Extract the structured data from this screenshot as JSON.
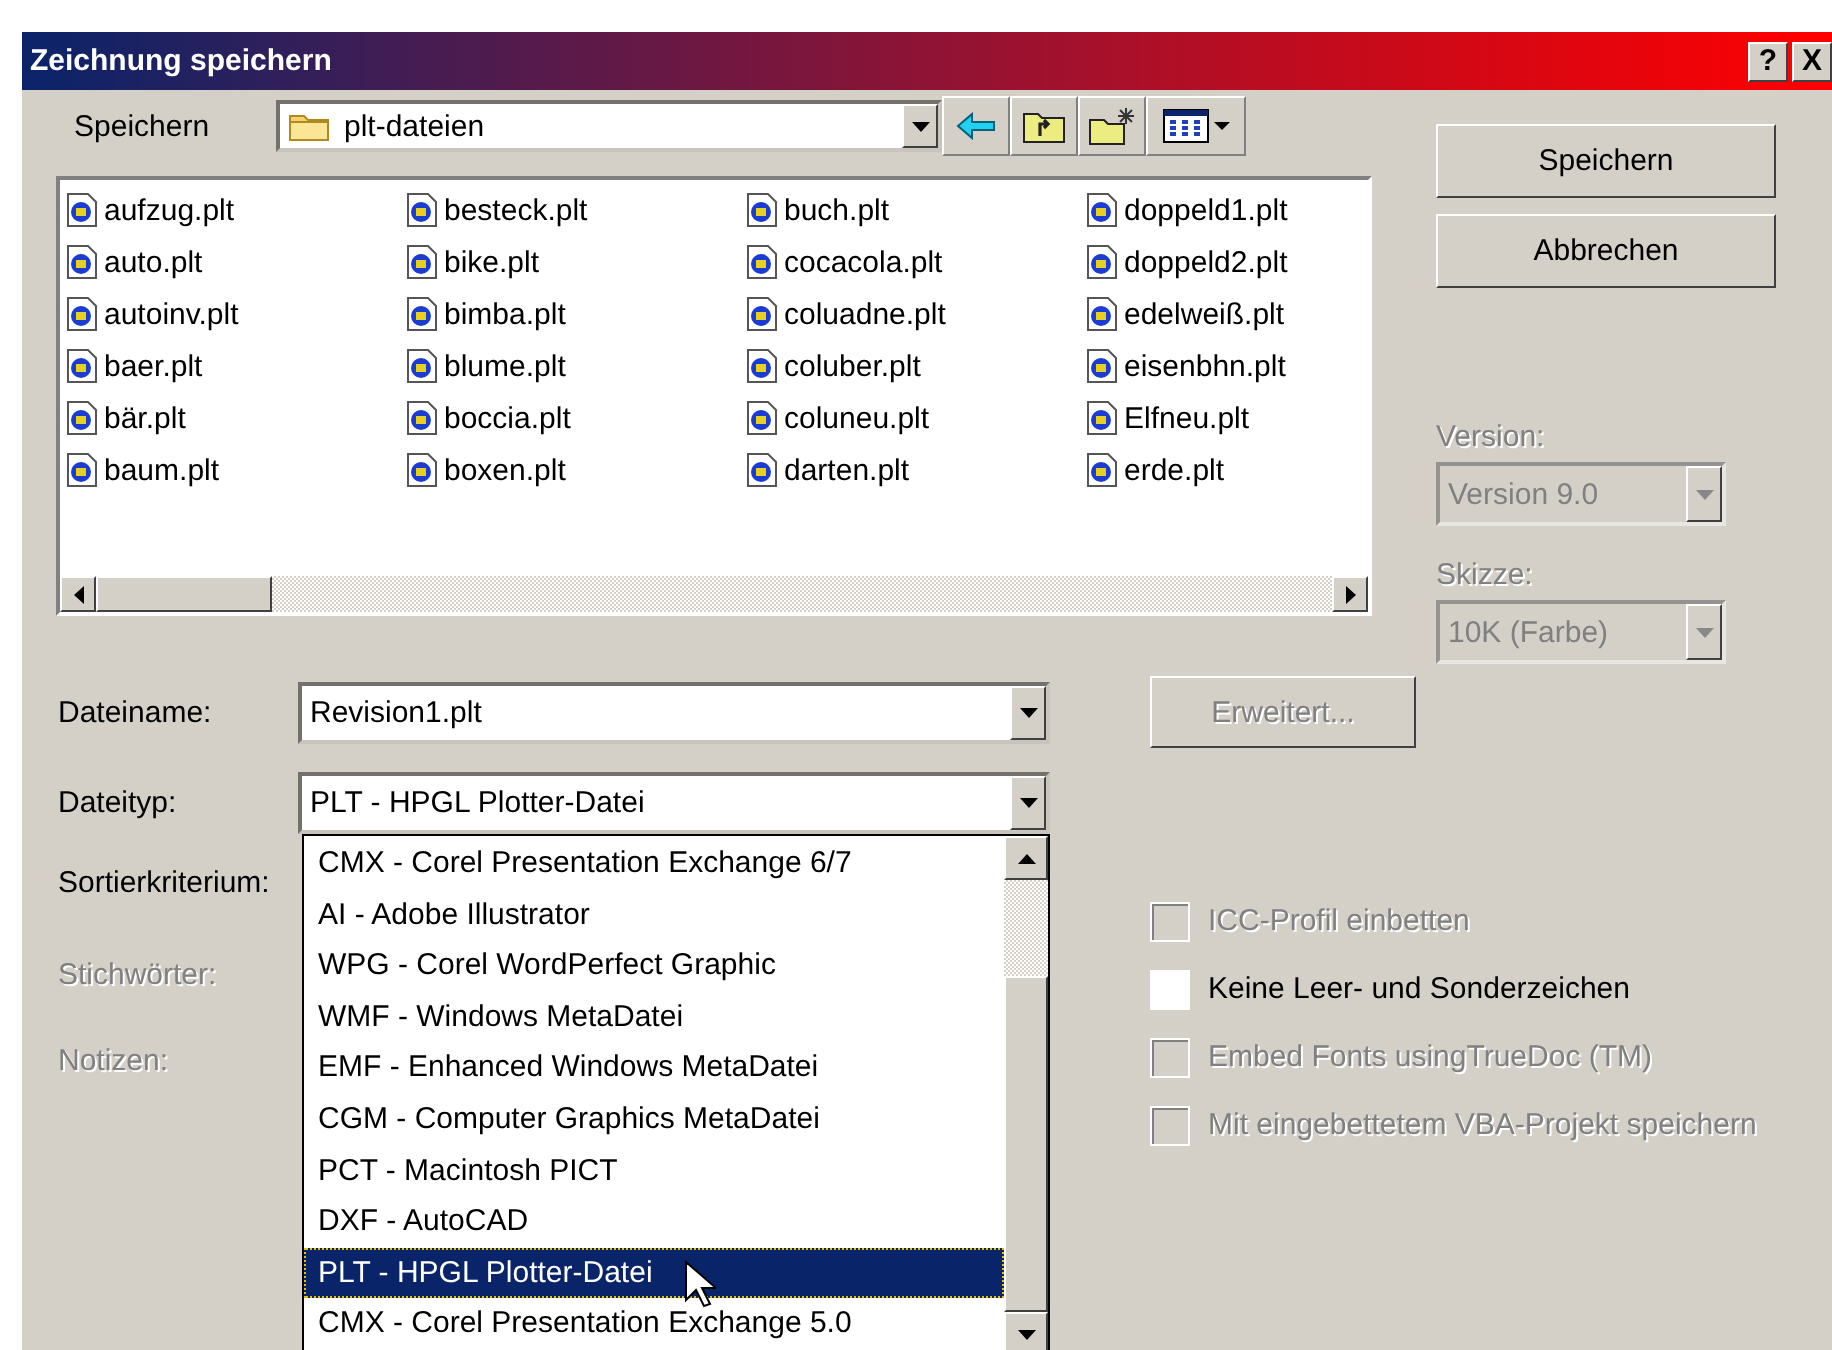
{
  "window": {
    "title": "Zeichnung speichern",
    "help": "?",
    "close": "X"
  },
  "save_in": {
    "label": "Speichern",
    "folder": "plt-dateien"
  },
  "files": [
    "aufzug.plt",
    "auto.plt",
    "autoinv.plt",
    "baer.plt",
    "bär.plt",
    "baum.plt",
    "besteck.plt",
    "bike.plt",
    "bimba.plt",
    "blume.plt",
    "boccia.plt",
    "boxen.plt",
    "buch.plt",
    "cocacola.plt",
    "coluadne.plt",
    "coluber.plt",
    "coluneu.plt",
    "darten.plt",
    "doppeld1.plt",
    "doppeld2.plt",
    "edelweiß.plt",
    "eisenbhn.plt",
    "Elfneu.plt",
    "erde.plt"
  ],
  "buttons": [
    {
      "label": "Speichern",
      "disabled": false
    },
    {
      "label": "Abbrechen",
      "disabled": false
    }
  ],
  "version": {
    "label": "Version:",
    "value": "Version 9.0",
    "disabled": true
  },
  "sketch": {
    "label": "Skizze:",
    "value": "10K (Farbe)",
    "disabled": true
  },
  "filename": {
    "label": "Dateiname:",
    "value": "Revision1.plt"
  },
  "filetype": {
    "label": "Dateityp:",
    "value": "PLT - HPGL Plotter-Datei",
    "expanded": true,
    "options": [
      {
        "label": "CMX - Corel Presentation Exchange 6/7",
        "selected": false
      },
      {
        "label": "AI - Adobe Illustrator",
        "selected": false
      },
      {
        "label": "WPG - Corel WordPerfect Graphic",
        "selected": false
      },
      {
        "label": "WMF - Windows MetaDatei",
        "selected": false
      },
      {
        "label": "EMF - Enhanced Windows MetaDatei",
        "selected": false
      },
      {
        "label": "CGM - Computer Graphics MetaDatei",
        "selected": false
      },
      {
        "label": "PCT - Macintosh PICT",
        "selected": false
      },
      {
        "label": "DXF - AutoCAD",
        "selected": false
      },
      {
        "label": "PLT - HPGL Plotter-Datei",
        "selected": true
      },
      {
        "label": "CMX - Corel Presentation Exchange 5.0",
        "selected": false
      }
    ]
  },
  "advanced_button": {
    "label": "Erweitert...",
    "disabled": true
  },
  "fields": [
    {
      "label": "Sortierkriterium:",
      "disabled": false
    },
    {
      "label": "Stichwörter:",
      "disabled": true
    },
    {
      "label": "Notizen:",
      "disabled": true
    }
  ],
  "options": [
    {
      "label": "ICC-Profil einbetten",
      "checked": false,
      "disabled": true
    },
    {
      "label": "Keine Leer- und Sonderzeichen",
      "checked": false,
      "disabled": false
    },
    {
      "label": "Embed Fonts usingTrueDoc (TM)",
      "checked": false,
      "disabled": true
    },
    {
      "label": "Mit eingebettetem VBA-Projekt speichern",
      "checked": false,
      "disabled": true
    }
  ]
}
